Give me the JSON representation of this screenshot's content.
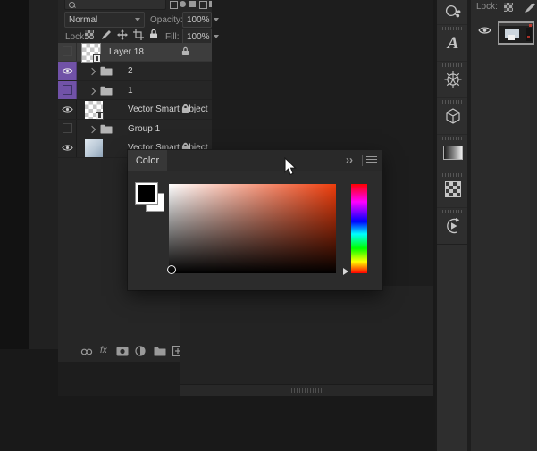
{
  "colors": {
    "accent_purple": "#7152a7",
    "selected_row": "#3d3d3d",
    "picker_hue_red": "#ee3d0c",
    "foreground_swatch": "#000000",
    "background_swatch": "#ffffff",
    "panel_bg": "#262626",
    "workspace_bg": "#1d1d1d"
  },
  "layers_panel": {
    "blend_mode": "Normal",
    "opacity_label": "Opacity:",
    "opacity_value": "100%",
    "lock_label": "Lock:",
    "fill_label": "Fill:",
    "fill_value": "100%",
    "rows": [
      {
        "name": "Layer 18"
      },
      {
        "name": "2"
      },
      {
        "name": "1"
      },
      {
        "name": "Vector Smart Object"
      },
      {
        "name": "Group 1"
      },
      {
        "name": "Vector Smart Object"
      }
    ],
    "footer": {
      "fx_label": "fx"
    }
  },
  "color_panel": {
    "tab_label": "Color",
    "collapse_label": "››"
  },
  "right_panel": {
    "lock_label": "Lock:"
  },
  "dock": {
    "glyphs_label": "A",
    "icons": [
      "nodes-icon",
      "glyphs-icon",
      "wheel-icon",
      "cube-3d-icon",
      "gradient-icon",
      "pattern-icon",
      "history-icon"
    ]
  }
}
